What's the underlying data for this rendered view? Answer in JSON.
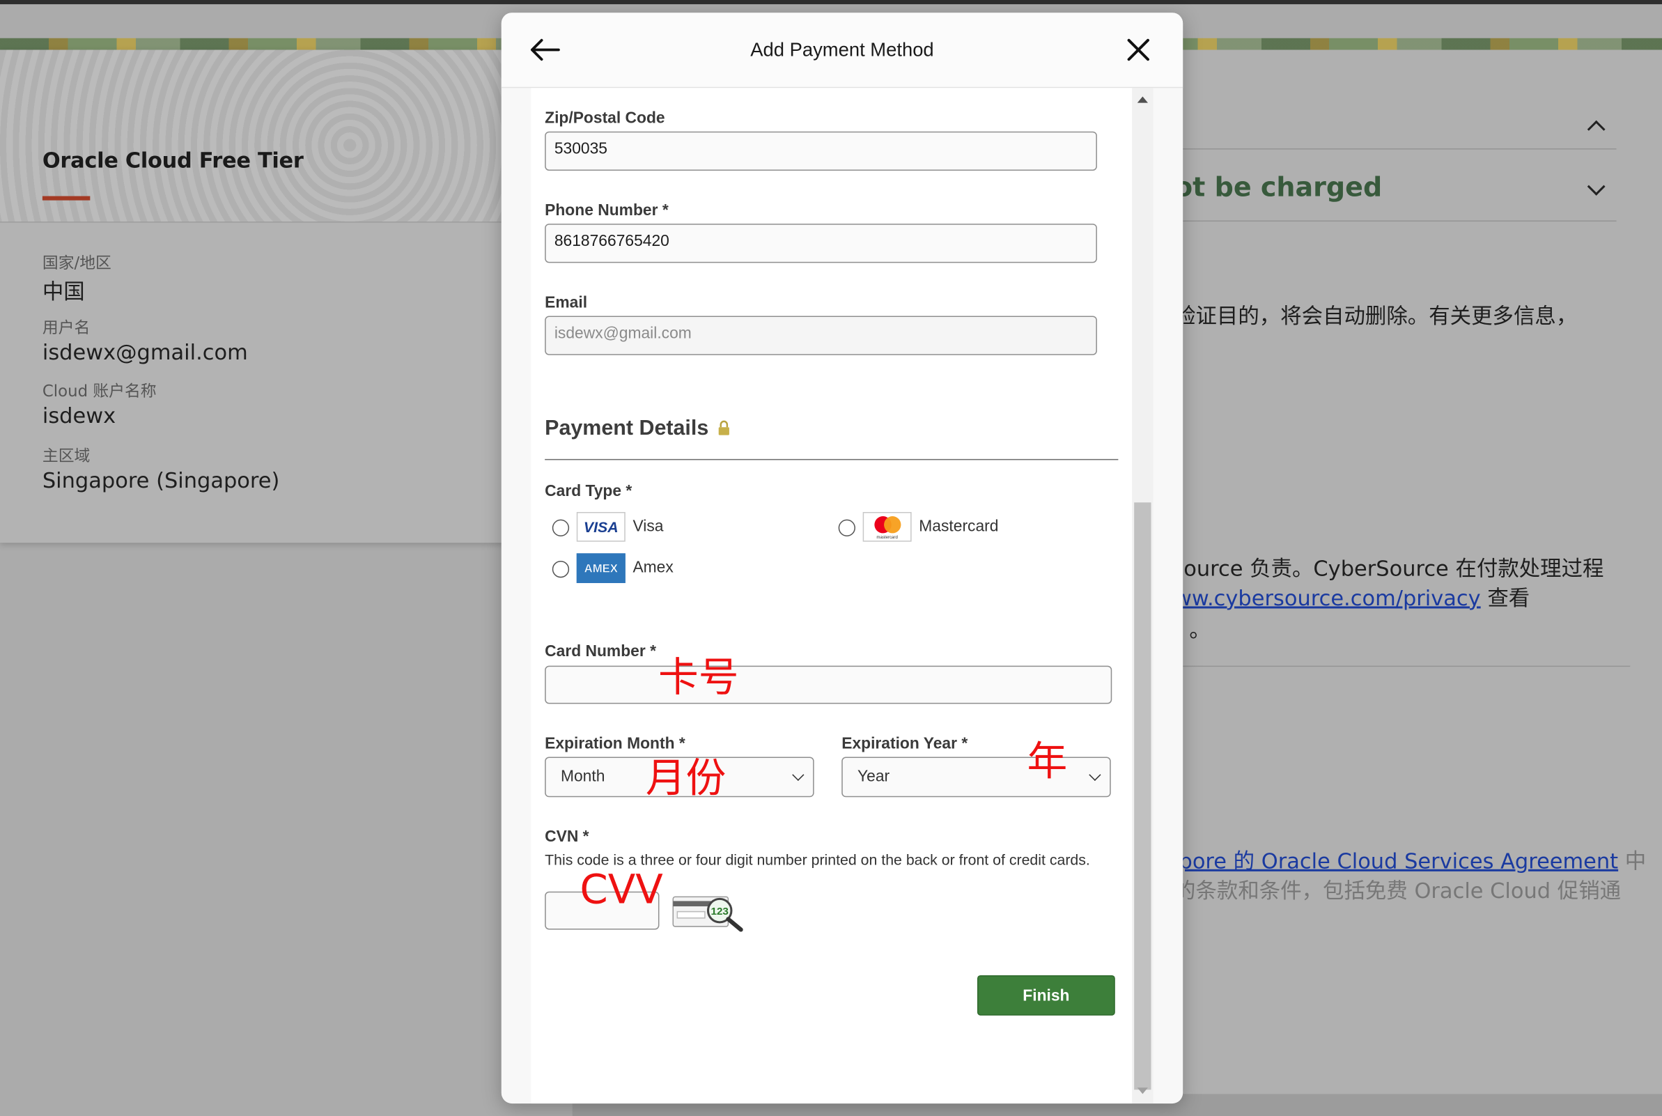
{
  "background": {
    "left_card": {
      "title": "Oracle Cloud Free Tier",
      "fields": [
        {
          "label": "国家/地区",
          "value": "中国"
        },
        {
          "label": "用户名",
          "value": "isdewx@gmail.com"
        },
        {
          "label": "Cloud 账户名称",
          "value": "isdewx"
        },
        {
          "label": "主区域",
          "value": "Singapore (Singapore)"
        }
      ]
    },
    "right_card": {
      "charged_heading": "ot be charged",
      "line_delete": "验证目的，将会自动删除。有关更多信息，",
      "line_cybersource_1": "Source 负责。CyberSource 在付款处理过程",
      "link_cybersource": "ww.cybersource.com/privacy",
      "after_link": " 查看",
      "dot": "。",
      "agreement_link": "apore 的 Oracle Cloud Services Agreement",
      "agreement_after": " 中",
      "line_terms": "的条款和条件，包括免费 Oracle Cloud 促销通"
    }
  },
  "modal": {
    "title": "Add Payment Method",
    "zip": {
      "label": "Zip/Postal Code",
      "value": "530035"
    },
    "phone": {
      "label": "Phone Number *",
      "value": "8618766765420"
    },
    "email": {
      "label": "Email",
      "placeholder": "isdewx@gmail.com"
    },
    "payment_section": "Payment Details",
    "card_type_label": "Card Type *",
    "card_types": [
      {
        "name": "Visa",
        "logo_text": "VISA"
      },
      {
        "name": "Mastercard",
        "logo_text": "mastercard"
      },
      {
        "name": "Amex",
        "logo_text": "AMEX"
      }
    ],
    "card_number": {
      "label": "Card Number *",
      "value": ""
    },
    "exp_month": {
      "label": "Expiration Month *",
      "selected": "Month"
    },
    "exp_year": {
      "label": "Expiration Year *",
      "selected": "Year"
    },
    "cvn": {
      "label": "CVN *",
      "hint": "This code is a three or four digit number printed on the back or front of credit cards.",
      "value": "",
      "icon_text": "123"
    },
    "finish_label": "Finish"
  },
  "annotations": {
    "card_number": "卡号",
    "month": "月份",
    "year": "年",
    "cvv": "CVV"
  },
  "colors": {
    "finish_button": "#3d7f3a",
    "annotation": "#ee1111",
    "accent_bar": "#a33a24",
    "link": "#1a3aa0"
  }
}
